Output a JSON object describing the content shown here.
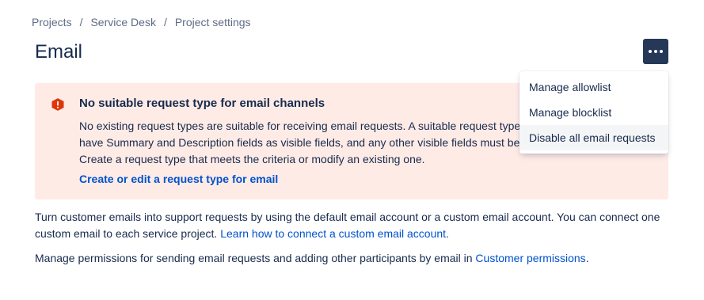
{
  "breadcrumb": {
    "items": [
      "Projects",
      "Service Desk",
      "Project settings"
    ],
    "separator": "/"
  },
  "page": {
    "title": "Email"
  },
  "more_button": {
    "icon": "more-horizontal-icon"
  },
  "alert": {
    "icon": "error-icon",
    "title": "No suitable request type for email channels",
    "body": "No existing request types are suitable for receiving email requests. A suitable request type must have Summary and Description fields as visible fields, and any other visible fields must be optional. Create a request type that meets the criteria or modify an existing one.",
    "link": "Create or edit a request type for email",
    "background": "#ffebe6",
    "icon_color": "#de350b"
  },
  "intro": {
    "text_before": "Turn customer emails into support requests by using the default email account or a custom email account. You can connect one custom email to each service project. ",
    "link": "Learn how to connect a custom email account",
    "text_after": "."
  },
  "permissions": {
    "text_before": "Manage permissions for sending email requests and adding other participants by email in ",
    "link": "Customer permissions",
    "text_after": "."
  },
  "dropdown": {
    "items": [
      "Manage allowlist",
      "Manage blocklist",
      "Disable all email requests"
    ],
    "hovered_index": 2
  },
  "colors": {
    "link": "#0052cc",
    "text": "#172b4d",
    "subtle": "#5e6c84",
    "button_dark": "#253858"
  }
}
